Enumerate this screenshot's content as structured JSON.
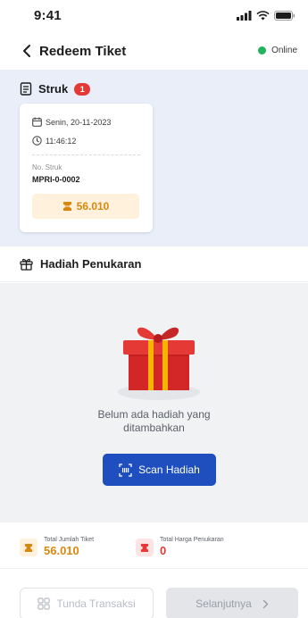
{
  "statusbar": {
    "time": "9:41"
  },
  "header": {
    "title": "Redeem Tiket",
    "status": "Online",
    "status_color": "#21b35c"
  },
  "struk": {
    "label": "Struk",
    "count": "1",
    "card": {
      "date": "Senin, 20-11-2023",
      "time": "11:46:12",
      "no_label": "No. Struk",
      "no_value": "MPRI-0-0002",
      "amount": "56.010"
    }
  },
  "hadiah": {
    "title": "Hadiah Penukaran",
    "empty_line1": "Belum ada hadiah yang",
    "empty_line2": "ditambahkan",
    "scan_label": "Scan Hadiah"
  },
  "summary": {
    "total_tiket_label": "Total Jumlah Tiket",
    "total_tiket_value": "56.010",
    "total_harga_label": "Total Harga Penukaran",
    "total_harga_value": "0"
  },
  "footer": {
    "tunda_label": "Tunda Transaksi",
    "next_label": "Selanjutnya"
  },
  "colors": {
    "primary": "#1f4fbf",
    "ticket_orange": "#d9880f",
    "red": "#e53935",
    "section_bg": "#e9eef9"
  }
}
